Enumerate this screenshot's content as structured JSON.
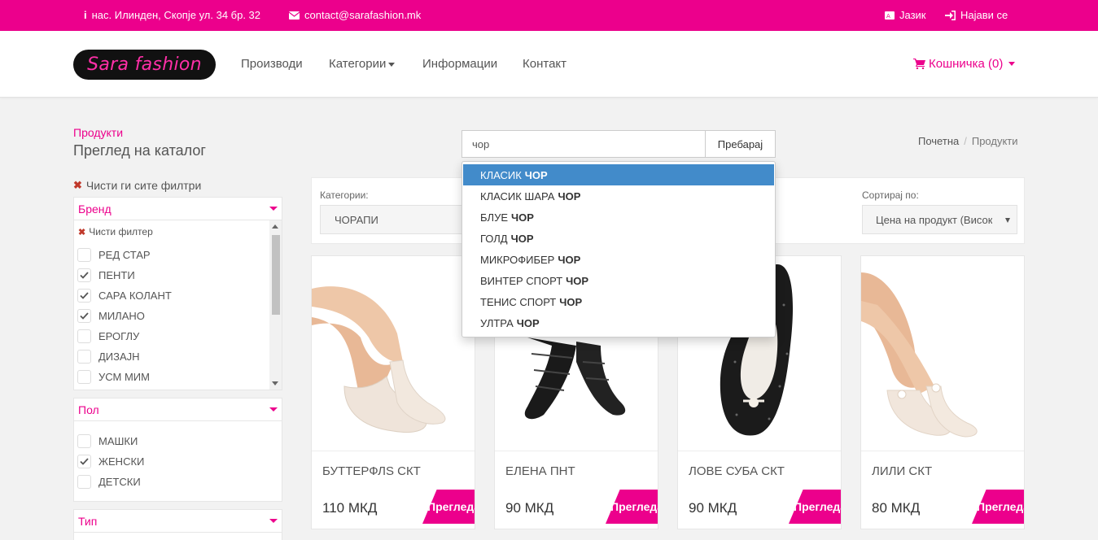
{
  "topbar": {
    "address": "нас. Илинден, Скопје ул. 34 бр. 32",
    "email": "contact@sarafashion.mk",
    "language": "Јазик",
    "login": "Најави се"
  },
  "header": {
    "logo": "Sara fashion",
    "nav": [
      "Производи",
      "Категории",
      "Информации",
      "Контакт"
    ],
    "cart": "Кошничка (0)"
  },
  "page": {
    "subtitle": "Продукти",
    "title": "Преглед на каталог"
  },
  "search": {
    "value": "чор",
    "button": "Пребарај",
    "suggestions": [
      {
        "pre": "КЛАСИК",
        "match": "ЧОР",
        "active": true
      },
      {
        "pre": "КЛАСИК ШАРА",
        "match": "ЧОР"
      },
      {
        "pre": "БЛУЕ",
        "match": "ЧОР"
      },
      {
        "pre": "ГОЛД",
        "match": "ЧОР"
      },
      {
        "pre": "МИКРОФИБЕР",
        "match": "ЧОР"
      },
      {
        "pre": "ВИНТЕР СПОРТ",
        "match": "ЧОР"
      },
      {
        "pre": "ТЕНИС СПОРТ",
        "match": "ЧОР"
      },
      {
        "pre": "УЛТРА",
        "match": "ЧОР"
      }
    ]
  },
  "breadcrumb": {
    "home": "Почетна",
    "current": "Продукти"
  },
  "sidebar": {
    "clear_all": "Чисти ги сите филтри",
    "brand": {
      "title": "Бренд",
      "clear": "Чисти филтер",
      "options": [
        {
          "label": "РЕД СТАР",
          "checked": false
        },
        {
          "label": "ПЕНТИ",
          "checked": true
        },
        {
          "label": "САРА КОЛАНТ",
          "checked": true
        },
        {
          "label": "МИЛАНО",
          "checked": true
        },
        {
          "label": "ЕРОГЛУ",
          "checked": false
        },
        {
          "label": "ДИЗАЈН",
          "checked": false
        },
        {
          "label": "УСМ МИМ",
          "checked": false
        }
      ]
    },
    "gender": {
      "title": "Пол",
      "options": [
        {
          "label": "МАШКИ",
          "checked": false
        },
        {
          "label": "ЖЕНСКИ",
          "checked": true
        },
        {
          "label": "ДЕТСКИ",
          "checked": false
        }
      ]
    },
    "type": {
      "title": "Тип"
    }
  },
  "filters": {
    "category_label": "Категории:",
    "category_value": "ЧОРАПИ",
    "sort_label": "Сортирај по:",
    "sort_value": "Цена на продукт (Висока кон ниска)"
  },
  "products": [
    {
      "name": "БУТТЕРФЛЅ СКТ",
      "price": "110 МКД",
      "view": "Прегледај"
    },
    {
      "name": "ЕЛЕНА ПНТ",
      "price": "90 МКД",
      "view": "Прегледај"
    },
    {
      "name": "ЛОВЕ СУБА СКТ",
      "price": "90 МКД",
      "view": "Прегледај"
    },
    {
      "name": "ЛИЛИ СКТ",
      "price": "80 МКД",
      "view": "Прегледај"
    }
  ],
  "colors": {
    "brand": "#ec008c",
    "active": "#428bca"
  }
}
